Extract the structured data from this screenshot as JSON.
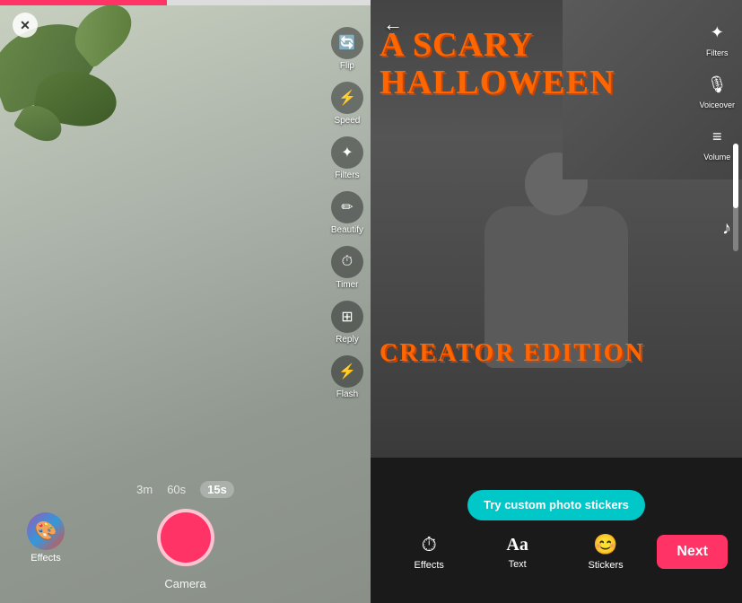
{
  "left_panel": {
    "title": "Camera",
    "close_icon": "✕",
    "progress_percent": 45,
    "toolbar": {
      "items": [
        {
          "icon": "👁",
          "label": "Flip",
          "name": "flip"
        },
        {
          "icon": "⚡",
          "label": "Speed",
          "name": "speed"
        },
        {
          "icon": "✦",
          "label": "Filters",
          "name": "filters"
        },
        {
          "icon": "✏",
          "label": "Beautify",
          "name": "beautify"
        },
        {
          "icon": "⏱",
          "label": "Timer",
          "name": "timer"
        },
        {
          "icon": "⊞",
          "label": "Reply",
          "name": "reply"
        },
        {
          "icon": "⚡",
          "label": "Flash",
          "name": "flash"
        }
      ]
    },
    "duration_options": [
      "3m",
      "60s",
      "15s"
    ],
    "active_duration": "15s",
    "effects_label": "Effects",
    "camera_label": "Camera"
  },
  "right_panel": {
    "back_icon": "←",
    "title_line1": "A SCARY",
    "title_line2": "HALLOWEEN",
    "creator_edition": "CREATOR EDITION",
    "toolbar": {
      "items": [
        {
          "icon": "✦",
          "label": "Filters",
          "name": "filters"
        },
        {
          "icon": "🎙",
          "label": "Voiceover",
          "name": "voiceover"
        },
        {
          "icon": "≡",
          "label": "Volume",
          "name": "volume"
        }
      ]
    },
    "music_note": "♪",
    "sticker_banner": "Try custom photo stickers",
    "bottom_tools": [
      {
        "icon": "⏱",
        "label": "Effects",
        "name": "effects"
      },
      {
        "icon": "Aa",
        "label": "Text",
        "name": "text"
      },
      {
        "icon": "☺",
        "label": "Stickers",
        "name": "stickers"
      }
    ],
    "next_button_label": "Next"
  }
}
